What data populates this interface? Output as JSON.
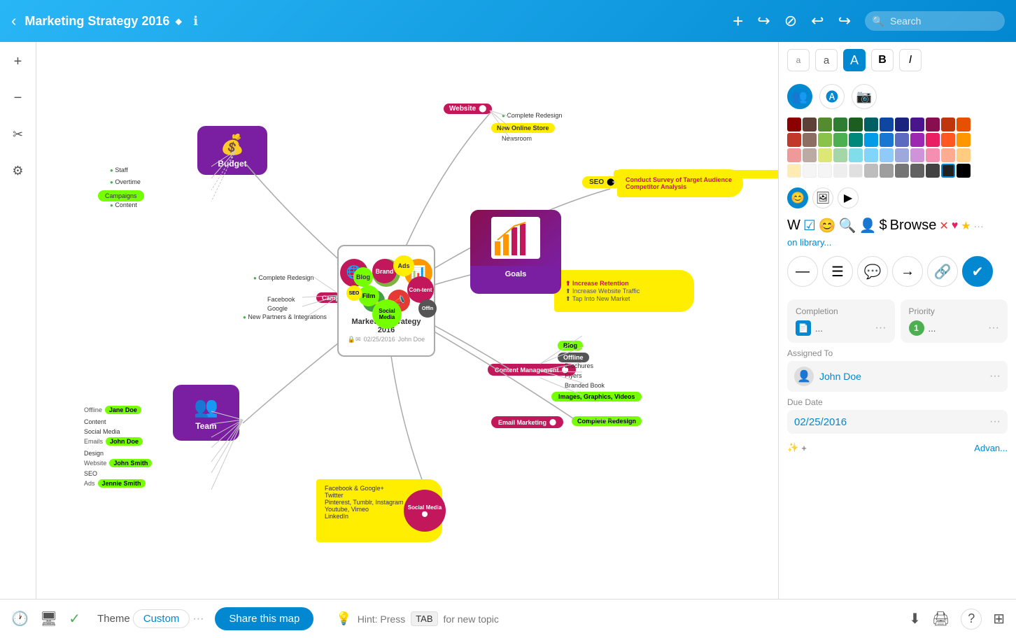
{
  "header": {
    "back_label": "‹",
    "title": "Marketing Strategy 2016",
    "title_arrow": "⬥",
    "info_icon": "ℹ",
    "add_btn": "+",
    "redo_curved": "↪",
    "cancel_circle": "⊘",
    "undo": "↩",
    "redo": "↪",
    "search_placeholder": "Search"
  },
  "left_sidebar": {
    "plus": "+",
    "minus": "−",
    "scissors": "✂",
    "gear": "⚙"
  },
  "right_panel": {
    "text_styles": {
      "a_small": "a",
      "a_medium": "a",
      "a_large_label": "A",
      "bold_label": "B",
      "italic_label": "I"
    },
    "icon_row1": {
      "people_icon": "👥",
      "face_icon": "😊",
      "camera_icon": "📷"
    },
    "colors": [
      "#8B0000",
      "#6B4C11",
      "#556B2F",
      "#006400",
      "#2E8B57",
      "#008080",
      "#191970",
      "#4B0082",
      "#800080",
      "#8B008B",
      "#A52A2A",
      "#B8860B",
      "#8B4513",
      "#A0522D",
      "#228B22",
      "#3CB371",
      "#20B2AA",
      "#4682B4",
      "#483D8B",
      "#6A0DAD",
      "#9932CC",
      "#C71585",
      "#CD853F",
      "#DAA520",
      "#CC7722",
      "#808000",
      "#6B8E23",
      "#00CED1",
      "#5F9EA0",
      "#1E90FF",
      "#7B68EE",
      "#DA70D6",
      "#FF69B4",
      "#F4A460",
      "#D2691E",
      "#BDB76B",
      "#9ACD32",
      "#32CD32",
      "#7FFFD4",
      "#87CEEB",
      "#6495ED",
      "#9370DB",
      "#DDA0DD",
      "#FFDEAD",
      "#F0E68C",
      "#EEE8AA",
      "#98FB98",
      "#90EE90",
      "#AFEEEE",
      "#E0F0FF",
      "#B0C4DE",
      "#C8A0DC",
      "#FFB6C1",
      "#FFFACD",
      "#FFFFE0",
      "#F5F5DC",
      "#E8FFE8",
      "#E0FFFF",
      "#F0F8FF",
      "#E6E6FA",
      "#E8E8E8",
      "#C0C0C0",
      "#A9A9A9",
      "#808080",
      "#696969",
      "#555555",
      "#404040",
      "#2F2F2F",
      "#1A1A1A",
      "#0A0A0A",
      "#000000",
      "#000000"
    ],
    "selected_color_index": 70,
    "stickers": [
      "😊",
      "📷",
      "🎬",
      "🔵",
      "👤",
      "🔍",
      "💰",
      "⭐",
      "❌",
      "❤️",
      "⭐",
      "···"
    ],
    "action_buttons": [
      "—",
      "☰",
      "💬",
      "→",
      "🔗",
      "✔"
    ],
    "completion": {
      "label": "Completion",
      "icon": "📄",
      "value": "..."
    },
    "priority": {
      "label": "Priority",
      "value": "...",
      "badge": "1"
    },
    "assigned_to": {
      "label": "Assigned To",
      "name": "John Doe"
    },
    "due_date": {
      "label": "Due Date",
      "value": "02/25/2016"
    },
    "advanced_label": "Advan...",
    "magic_label": "✨+"
  },
  "mind_map": {
    "center_title": "Marketing Strategy 2016",
    "center_date": "02/25/2016",
    "center_author": "John Doe",
    "budget_label": "Budget",
    "team_label": "Team",
    "goals_label": "Goals",
    "website_label": "Website",
    "seo_label": "SEO",
    "campaigns_label": "Campaigns",
    "ads_label": "Ads",
    "content_mgmt_label": "Content Management",
    "social_label": "Social Media",
    "email_label": "Email Marketing",
    "nodes": {
      "budget_subnodes": [
        "Staff",
        "Overtime",
        "Campaigns",
        "Content"
      ],
      "website_subnodes": [
        "Complete Redesign",
        "New Online Store",
        "Newsroom"
      ],
      "seo_subnodes": [
        "Conduct Survey of Target Audience",
        "Competitor Analysis"
      ],
      "campaigns_subnodes": [
        "Complete Redesign",
        "Facebook",
        "Google",
        "New Partners & Integrations"
      ],
      "goals_subnodes": [
        "Increase Retention",
        "Increase Website Traffic",
        "Tap Into New Market"
      ],
      "team_subnodes": [
        "Jane Doe (Offline)",
        "John Doe (Content, Social Media, Emails)",
        "John Smith (Design, Website, SEO, Ads)",
        "Jennie Smith"
      ],
      "content_subnodes": [
        "Brochures",
        "Flyers",
        "Branded Book",
        "Blog",
        "Offline",
        "Images Graphics Videos"
      ],
      "social_subnodes": [
        "Facebook & Google+",
        "Twitter",
        "Pinterest Tumblr Instagram",
        "Youtube Vimeo",
        "LinkedIn"
      ],
      "email_subnodes": [
        "Complete Redesign"
      ]
    }
  },
  "footer": {
    "history_icon": "🕐",
    "screen_icon": "🖥",
    "check_icon": "✓",
    "theme_label": "Theme",
    "custom_label": "Custom",
    "dots_label": "···",
    "share_label": "Share this map",
    "hint_icon": "💡",
    "hint_text": "Hint: Press",
    "hint_key": "TAB",
    "hint_suffix": "for new topic",
    "download_icon": "⬇",
    "print_icon": "🖨",
    "help_icon": "?",
    "sidebar_icon": "⊞"
  }
}
